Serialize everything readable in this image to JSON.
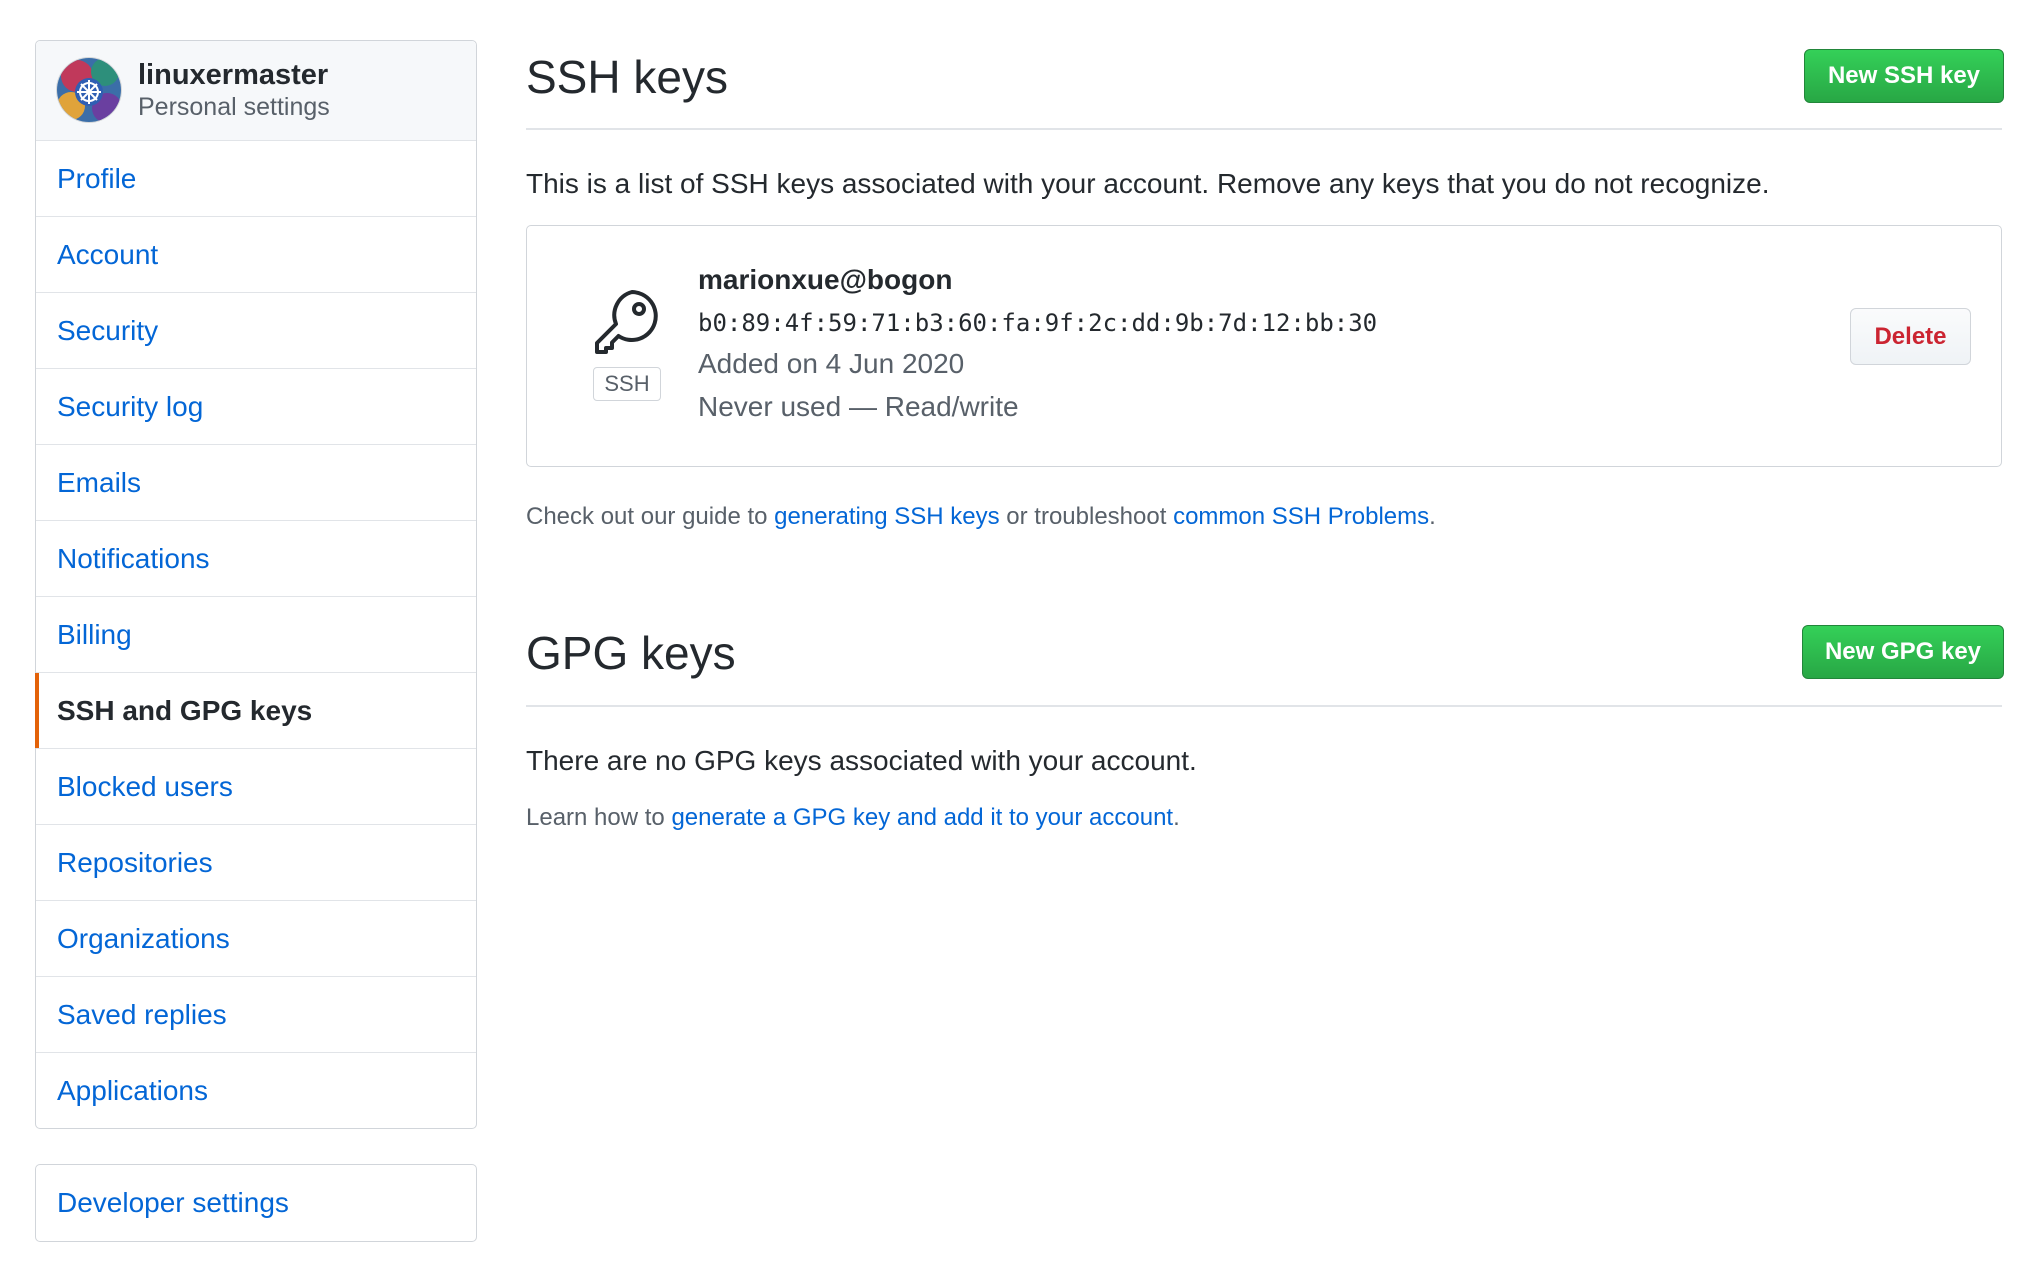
{
  "user": {
    "name": "linuxermaster",
    "subtitle": "Personal settings"
  },
  "sidebar": {
    "items": [
      {
        "label": "Profile",
        "selected": false
      },
      {
        "label": "Account",
        "selected": false
      },
      {
        "label": "Security",
        "selected": false
      },
      {
        "label": "Security log",
        "selected": false
      },
      {
        "label": "Emails",
        "selected": false
      },
      {
        "label": "Notifications",
        "selected": false
      },
      {
        "label": "Billing",
        "selected": false
      },
      {
        "label": "SSH and GPG keys",
        "selected": true
      },
      {
        "label": "Blocked users",
        "selected": false
      },
      {
        "label": "Repositories",
        "selected": false
      },
      {
        "label": "Organizations",
        "selected": false
      },
      {
        "label": "Saved replies",
        "selected": false
      },
      {
        "label": "Applications",
        "selected": false
      }
    ],
    "developer_settings": "Developer settings"
  },
  "ssh": {
    "title": "SSH keys",
    "new_button": "New SSH key",
    "description": "This is a list of SSH keys associated with your account. Remove any keys that you do not recognize.",
    "keys": [
      {
        "title": "marionxue@bogon",
        "fingerprint": "b0:89:4f:59:71:b3:60:fa:9f:2c:dd:9b:7d:12:bb:30",
        "added": "Added on 4 Jun 2020",
        "usage": "Never used — Read/write",
        "type_label": "SSH",
        "icon": "key-icon",
        "delete_label": "Delete"
      }
    ],
    "guide": {
      "prefix": "Check out our guide to ",
      "link1": "generating SSH keys",
      "middle": " or troubleshoot ",
      "link2": "common SSH Problems",
      "suffix": "."
    }
  },
  "gpg": {
    "title": "GPG keys",
    "new_button": "New GPG key",
    "empty_text": "There are no GPG keys associated with your account.",
    "learn": {
      "prefix": "Learn how to ",
      "link": "generate a GPG key and add it to your account",
      "suffix": "."
    }
  },
  "colors": {
    "link": "#0366d6",
    "primary_button": "#28a745",
    "danger": "#cb2431",
    "selected_indicator": "#e36209"
  }
}
